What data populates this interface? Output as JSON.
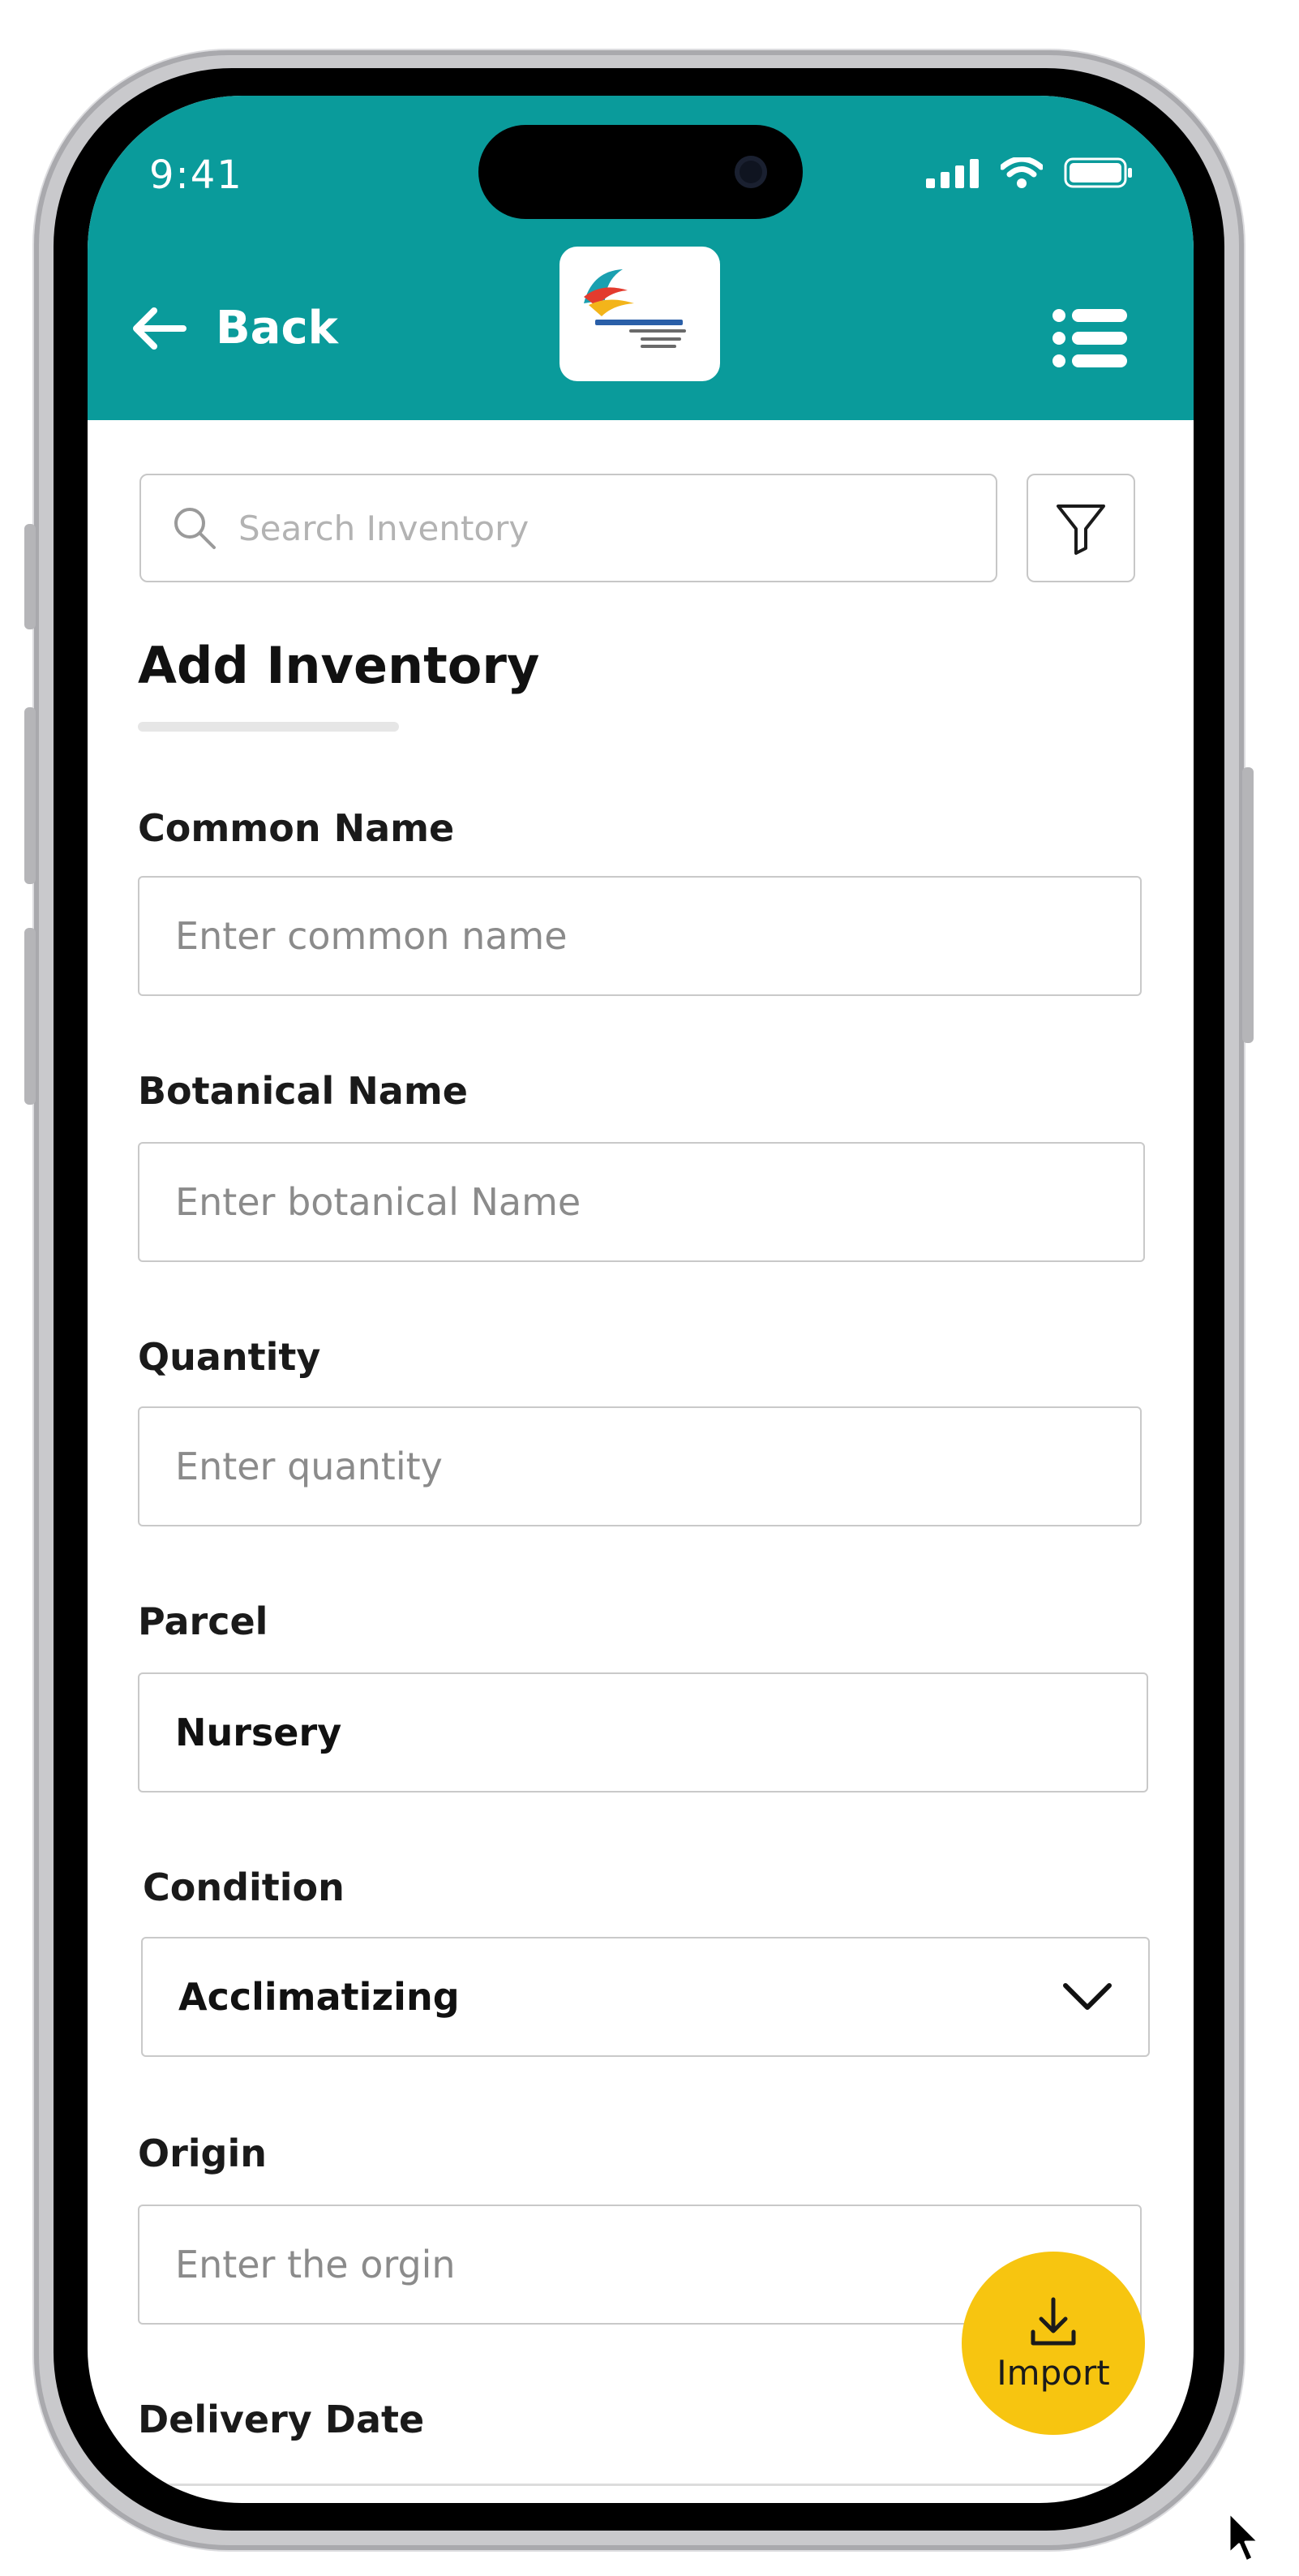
{
  "status_bar": {
    "time": "9:41"
  },
  "header": {
    "back_label": "Back",
    "logo_alt": "app-logo",
    "menu_icon": "list-menu-icon",
    "bg_color": "#0a9b9b"
  },
  "search": {
    "placeholder": "Search Inventory",
    "filter_icon": "filter-icon"
  },
  "page": {
    "title": "Add Inventory"
  },
  "form": {
    "common_name": {
      "label": "Common Name",
      "placeholder": "Enter common name"
    },
    "botanical_name": {
      "label": "Botanical Name",
      "placeholder": "Enter botanical Name"
    },
    "quantity": {
      "label": "Quantity",
      "placeholder": "Enter quantity"
    },
    "parcel": {
      "label": "Parcel",
      "value": "Nursery"
    },
    "condition": {
      "label": "Condition",
      "value": "Acclimatizing"
    },
    "origin": {
      "label": "Origin",
      "placeholder": "Enter the orgin"
    },
    "delivery_date": {
      "label": "Delivery Date"
    }
  },
  "fab": {
    "label": "Import",
    "color": "#f7c510"
  }
}
